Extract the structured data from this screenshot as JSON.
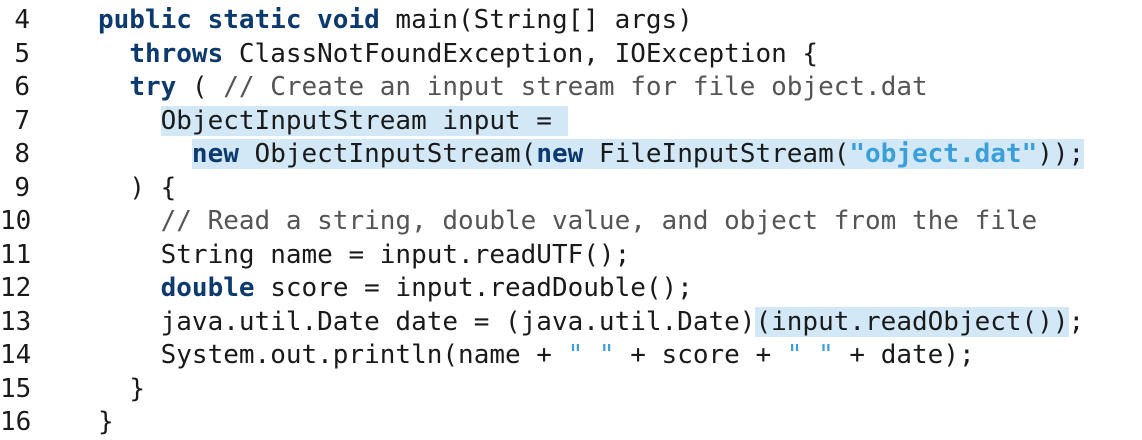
{
  "code_lines": [
    {
      "num": "4",
      "indent": "",
      "parts": [
        {
          "t": "kw",
          "v": "public static void"
        },
        {
          "t": "p",
          "v": " main(String[] args)"
        }
      ]
    },
    {
      "num": "5",
      "indent": "  ",
      "parts": [
        {
          "t": "kw",
          "v": "throws"
        },
        {
          "t": "p",
          "v": " ClassNotFoundException, IOException {"
        }
      ]
    },
    {
      "num": "6",
      "indent": "  ",
      "parts": [
        {
          "t": "kw",
          "v": "try"
        },
        {
          "t": "p",
          "v": " ( "
        },
        {
          "t": "c",
          "v": "// Create an input stream for file object.dat"
        }
      ]
    },
    {
      "num": "7",
      "indent": "    ",
      "parts": [
        {
          "t": "hp",
          "v": "ObjectInputStream input = "
        }
      ]
    },
    {
      "num": "8",
      "indent": "      ",
      "parts": [
        {
          "t": "hk",
          "v": "new"
        },
        {
          "t": "hp",
          "v": " ObjectInputStream("
        },
        {
          "t": "hk",
          "v": "new"
        },
        {
          "t": "hp",
          "v": " FileInputStream("
        },
        {
          "t": "hs",
          "v": "\"object.dat\""
        },
        {
          "t": "hp",
          "v": "));"
        }
      ]
    },
    {
      "num": "9",
      "indent": "  ",
      "parts": [
        {
          "t": "p",
          "v": ") {"
        }
      ]
    },
    {
      "num": "10",
      "indent": "    ",
      "parts": [
        {
          "t": "c",
          "v": "// Read a string, double value, and object from the file"
        }
      ]
    },
    {
      "num": "11",
      "indent": "    ",
      "parts": [
        {
          "t": "p",
          "v": "String name = input.readUTF();"
        }
      ]
    },
    {
      "num": "12",
      "indent": "    ",
      "parts": [
        {
          "t": "kw",
          "v": "double"
        },
        {
          "t": "p",
          "v": " score = input.readDouble();"
        }
      ]
    },
    {
      "num": "13",
      "indent": "    ",
      "parts": [
        {
          "t": "p",
          "v": "java.util.Date date = (java.util.Date)"
        },
        {
          "t": "hp",
          "v": "(input.readObject())"
        },
        {
          "t": "p",
          "v": ";"
        }
      ]
    },
    {
      "num": "14",
      "indent": "    ",
      "parts": [
        {
          "t": "p",
          "v": "System.out.println(name + "
        },
        {
          "t": "s",
          "v": "\" \""
        },
        {
          "t": "p",
          "v": " + score + "
        },
        {
          "t": "s",
          "v": "\" \""
        },
        {
          "t": "p",
          "v": " + date);"
        }
      ]
    },
    {
      "num": "15",
      "indent": "  ",
      "parts": [
        {
          "t": "p",
          "v": "}"
        }
      ]
    },
    {
      "num": "16",
      "indent": "",
      "parts": [
        {
          "t": "p",
          "v": "}"
        }
      ]
    }
  ]
}
